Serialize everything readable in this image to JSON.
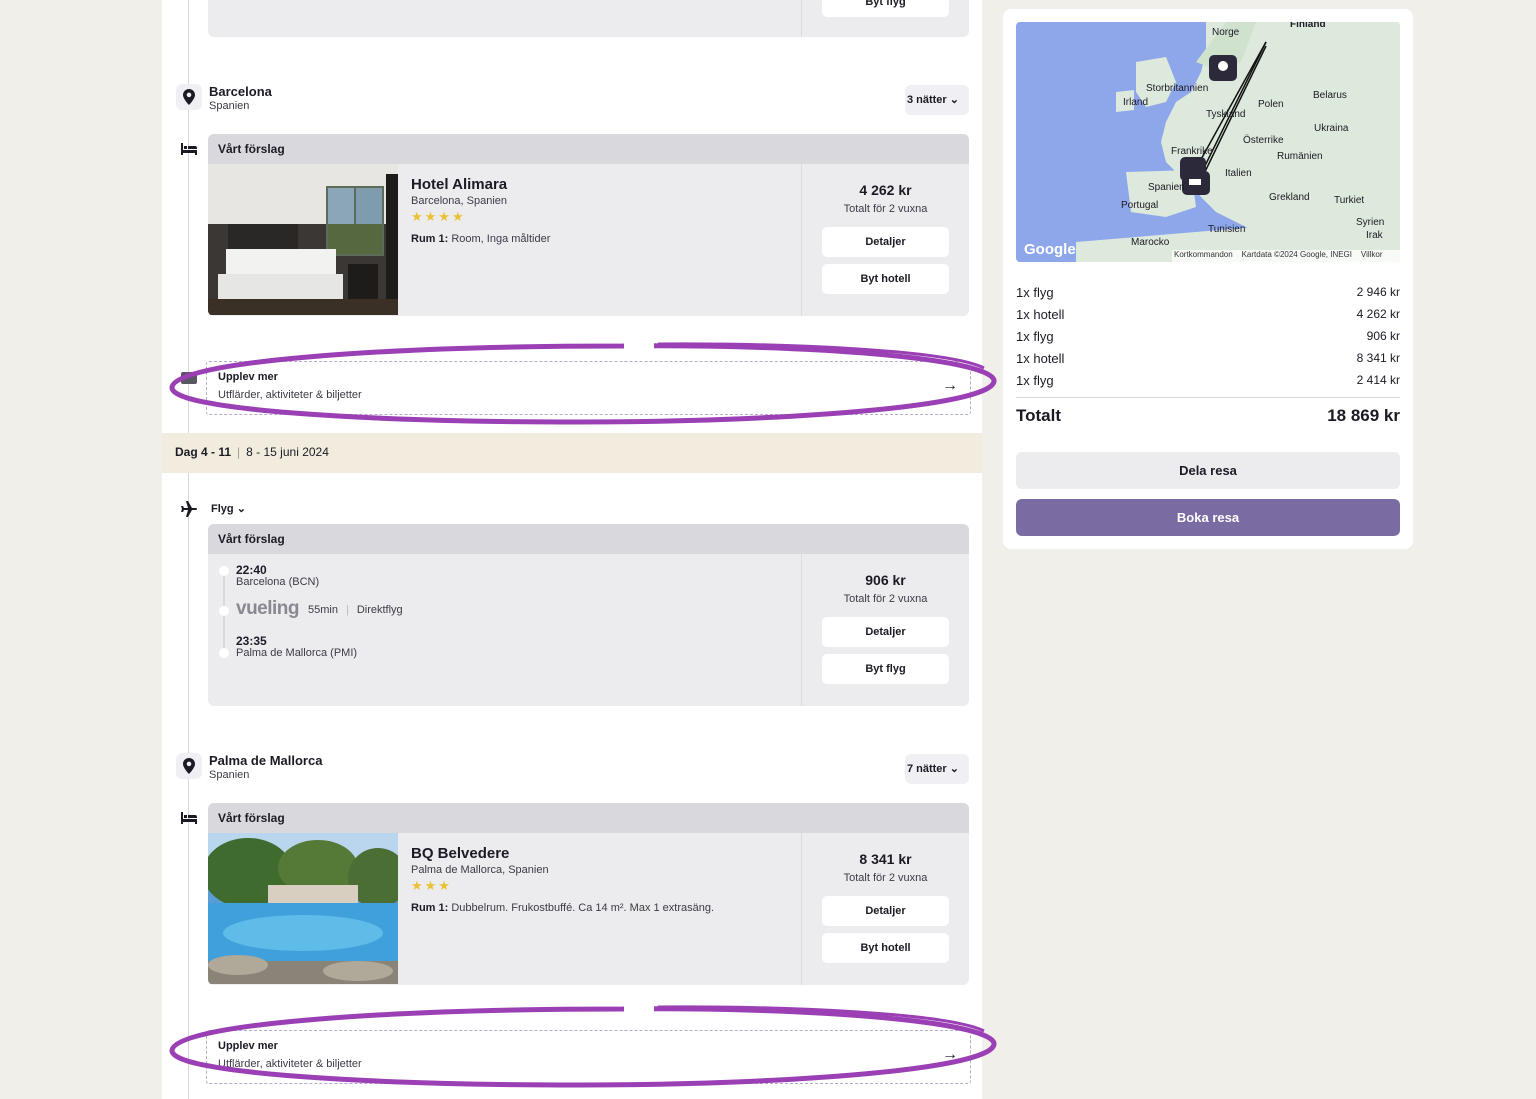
{
  "top_card": {
    "swap_label": "Byt flyg"
  },
  "barcelona": {
    "name": "Barcelona",
    "country": "Spanien",
    "nights": "3 nätter",
    "hotel": {
      "header": "Vårt förslag",
      "name": "Hotel Alimara",
      "location": "Barcelona, Spanien",
      "stars": "★★★★",
      "room_label": "Rum 1:",
      "room_desc": "Room, Inga måltider",
      "price": "4 262 kr",
      "price_sub": "Totalt för 2 vuxna",
      "details_label": "Detaljer",
      "swap_label": "Byt hotell"
    },
    "upplev": {
      "title": "Upplev mer",
      "subtitle": "Utflärder, aktiviteter & biljetter"
    }
  },
  "day_band": {
    "days": "Dag 4 - 11",
    "dates": "8 - 15 juni 2024"
  },
  "flight": {
    "selector": "Flyg",
    "header": "Vårt förslag",
    "dep_time": "22:40",
    "dep_place": "Barcelona (BCN)",
    "airline": "vueling",
    "duration": "55min",
    "type": "Direktflyg",
    "arr_time": "23:35",
    "arr_place": "Palma de Mallorca (PMI)",
    "price": "906 kr",
    "price_sub": "Totalt för 2 vuxna",
    "details_label": "Detaljer",
    "swap_label": "Byt flyg"
  },
  "palma": {
    "name": "Palma de Mallorca",
    "country": "Spanien",
    "nights": "7 nätter",
    "hotel": {
      "header": "Vårt förslag",
      "name": "BQ Belvedere",
      "location": "Palma de Mallorca, Spanien",
      "stars": "★★★",
      "room_label": "Rum 1:",
      "room_desc": "Dubbelrum. Frukostbuffé. Ca 14 m². Max 1 extrasäng.",
      "price": "8 341 kr",
      "price_sub": "Totalt för 2 vuxna",
      "details_label": "Detaljer",
      "swap_label": "Byt hotell"
    },
    "upplev": {
      "title": "Upplev mer",
      "subtitle": "Utflärder, aktiviteter & biljetter"
    }
  },
  "map": {
    "labels": [
      "Finland",
      "Norge",
      "Storbritannien",
      "Irland",
      "Belarus",
      "Polen",
      "Tyskland",
      "Ukraina",
      "Österrike",
      "Frankrike",
      "Rumänien",
      "Italien",
      "Spanien",
      "Portugal",
      "Grekland",
      "Turkiet",
      "Syrien",
      "Tunisien",
      "Irak",
      "Marocko"
    ],
    "google": "Google",
    "attribution": [
      "Kortkommandon",
      "Kartdata ©2024 Google, INEGI",
      "Villkor"
    ]
  },
  "summary": {
    "items": [
      {
        "label": "1x flyg",
        "amount": "2 946 kr"
      },
      {
        "label": "1x hotell",
        "amount": "4 262 kr"
      },
      {
        "label": "1x flyg",
        "amount": "906 kr"
      },
      {
        "label": "1x hotell",
        "amount": "8 341 kr"
      },
      {
        "label": "1x flyg",
        "amount": "2 414 kr"
      }
    ],
    "total_label": "Totalt",
    "total_amount": "18 869 kr",
    "share_label": "Dela resa",
    "book_label": "Boka resa"
  },
  "colors": {
    "accent": "#7b6ba3",
    "highlight": "#9b3fb5",
    "stars": "#e9c233",
    "band": "#f1ecde"
  }
}
